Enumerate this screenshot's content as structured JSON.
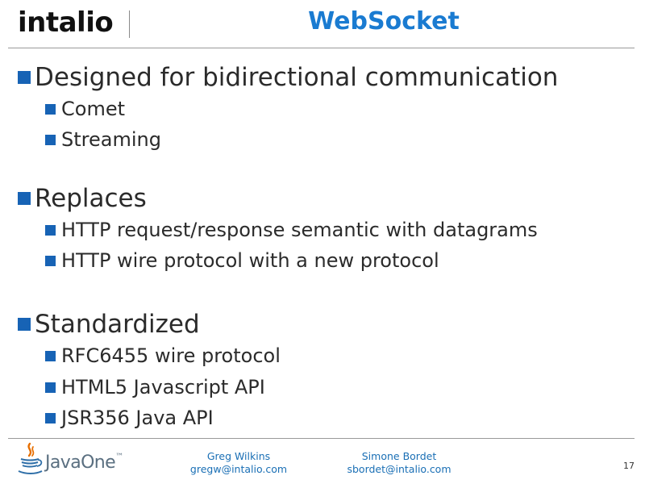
{
  "header": {
    "logo_text": "intalio",
    "title": "WebSocket"
  },
  "content": {
    "sections": [
      {
        "heading": "Designed for bidirectional communication",
        "items": [
          "Comet",
          "Streaming"
        ]
      },
      {
        "heading": "Replaces",
        "items": [
          "HTTP request/response semantic with datagrams",
          "HTTP wire protocol with a new protocol"
        ]
      },
      {
        "heading": "Standardized",
        "items": [
          "RFC6455 wire protocol",
          "HTML5 Javascript API",
          "JSR356 Java API"
        ]
      }
    ]
  },
  "footer": {
    "logo_text": "JavaOne",
    "logo_mark": "™",
    "authors": [
      {
        "name": "Greg Wilkins",
        "email": "gregw@intalio.com"
      },
      {
        "name": "Simone Bordet",
        "email": "sbordet@intalio.com"
      }
    ],
    "page_number": "17"
  },
  "colors": {
    "title": "#1a7bd1",
    "bullet": "#1763b5",
    "footer_text": "#1a6fb5",
    "java_flame": "#e76f00",
    "java_cup": "#2f6fa8"
  }
}
